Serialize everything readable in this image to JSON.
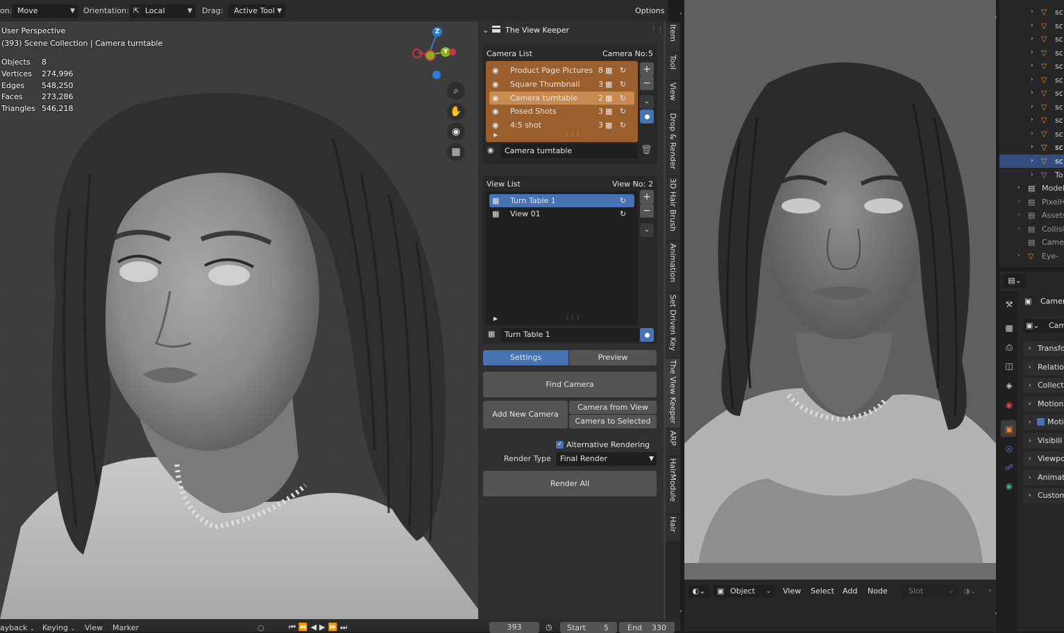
{
  "topbar": {
    "mode_label_partial": "on:",
    "mode_value": "Move",
    "orientation_label": "Orientation:",
    "orientation_value": "Local",
    "drag_label": "Drag:",
    "drag_value": "Active Tool",
    "options_label": "Options"
  },
  "viewport": {
    "perspective": "User Perspective",
    "collection": "(393) Scene Collection | Camera turntable",
    "stats": [
      {
        "label": "Objects",
        "value": "8"
      },
      {
        "label": "Vertices",
        "value": "274,996"
      },
      {
        "label": "Edges",
        "value": "548,250"
      },
      {
        "label": "Faces",
        "value": "273,286"
      },
      {
        "label": "Triangles",
        "value": "546,218"
      }
    ],
    "gizmo": {
      "z": "Z",
      "y": "Y"
    }
  },
  "view_keeper": {
    "title": "The View Keeper",
    "camera_list_label": "Camera List",
    "camera_no_label": "Camera No:",
    "camera_no": "5",
    "cameras": [
      {
        "name": "Product Page Pictures",
        "count": "8"
      },
      {
        "name": "Square Thumbnail",
        "count": "3"
      },
      {
        "name": "Camera turntable",
        "count": "2"
      },
      {
        "name": "Posed Shots",
        "count": "3"
      },
      {
        "name": "4:5 shot",
        "count": "3"
      }
    ],
    "active_camera": "Camera turntable",
    "view_list_label": "View List",
    "view_no_label": "View No:",
    "view_no": "2",
    "views": [
      {
        "name": "Turn Table 1"
      },
      {
        "name": "View 01"
      }
    ],
    "active_view": "Turn Table 1",
    "tab_settings": "Settings",
    "tab_preview": "Preview",
    "find_camera": "Find Camera",
    "add_new_camera": "Add New Camera",
    "camera_from_view": "Camera from View",
    "camera_to_selected": "Camera to Selected",
    "alt_rendering": "Alternative Rendering",
    "render_type_label": "Render Type",
    "render_type_value": "Final Render",
    "render_all": "Render All"
  },
  "vertical_tabs": [
    "Item",
    "Tool",
    "View",
    "Drop & Render",
    "3D Hair Brush",
    "Animation",
    "Set Driven Key",
    "The View Keeper",
    "ARP",
    "HairModule",
    "Hair"
  ],
  "timeline": {
    "playback": "ayback",
    "keying": "Keying",
    "view": "View",
    "marker": "Marker",
    "frame": "393",
    "start_label": "Start",
    "start": "5",
    "end_label": "End",
    "end": "330"
  },
  "shader_bar": {
    "object": "Object",
    "view": "View",
    "select": "Select",
    "add": "Add",
    "node": "Node",
    "slot": "Slot"
  },
  "outliner": {
    "rows": [
      "sc",
      "sc",
      "sc",
      "sc",
      "sc",
      "sc",
      "sc",
      "sc",
      "sc",
      "sc",
      "sc",
      "sc",
      "To",
      "Model",
      "PixelH",
      "Assets",
      "Collisi",
      "Camer",
      "Eye-"
    ]
  },
  "properties": {
    "object_name": "Camer",
    "data_name": "Cam",
    "panels": [
      "Transfo",
      "Relation",
      "Collecti",
      "Motion",
      "Moti",
      "Visibili",
      "Viewpo",
      "Animat",
      "Custom"
    ]
  },
  "colors": {
    "camera_selected": "#bf7a3c",
    "view_selected": "#4772b3",
    "outliner_selected": "#334d80"
  }
}
